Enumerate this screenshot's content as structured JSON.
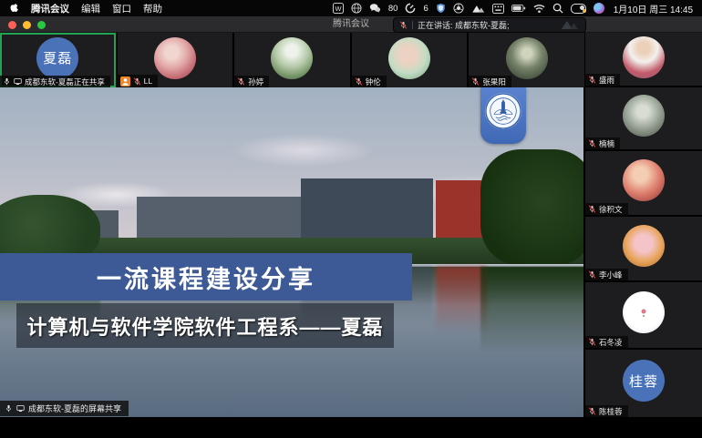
{
  "menubar": {
    "app_name": "腾讯会议",
    "menus": [
      "编辑",
      "窗口",
      "帮助"
    ],
    "wechat_badge": "80",
    "gauge_badge": "6",
    "clock": "1月10日 周三 14:45"
  },
  "window": {
    "title": "腾讯会议"
  },
  "speaking_indicator": {
    "text": "正在讲话: 成都东软-夏磊;"
  },
  "participants": {
    "top_row": [
      {
        "label": "成都东软-夏磊正在共享",
        "avatar_text": "夏磊"
      },
      {
        "label": "LL"
      },
      {
        "label": "孙婷"
      },
      {
        "label": "钟伦"
      },
      {
        "label": "张果阳"
      }
    ],
    "right_column": [
      {
        "label": "盛雨"
      },
      {
        "label": "楠楠"
      },
      {
        "label": "徐积文"
      },
      {
        "label": "李小峰"
      },
      {
        "label": "石冬凌"
      },
      {
        "label": "陈桂蓉",
        "avatar_text": "桂蓉"
      }
    ]
  },
  "stage": {
    "share_label": "成都东软-夏磊的屏幕共享",
    "slide_title": "一流课程建设分享",
    "slide_subtitle": "计算机与软件学院软件工程系——夏磊"
  },
  "colors": {
    "banner_blue": "#3d5a97",
    "avatar_blue": "#4a72b8",
    "active_speaker_green": "#21a356",
    "muted_mic_red": "#e03c3c",
    "waiting_badge_orange": "#e8882a"
  }
}
